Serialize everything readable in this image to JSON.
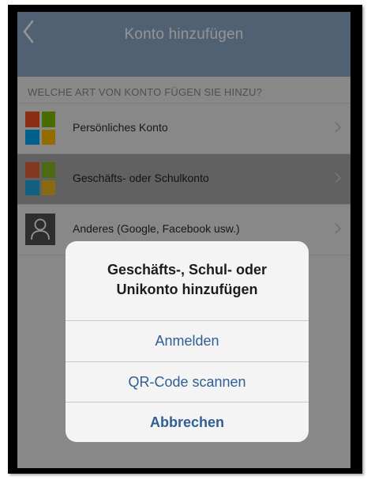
{
  "navbar": {
    "title": "Konto hinzufügen",
    "back_icon": "chevron-left-icon"
  },
  "account_types": {
    "header": "WELCHE ART VON KONTO FÜGEN SIE HINZU?",
    "items": [
      {
        "label": "Persönliches Konto",
        "icon": "microsoft-logo-icon"
      },
      {
        "label": "Geschäfts- oder Schulkonto",
        "icon": "microsoft-logo-icon",
        "selected": true
      },
      {
        "label": "Anderes (Google, Facebook usw.)",
        "icon": "user-icon"
      }
    ]
  },
  "action_sheet": {
    "title_line1": "Geschäfts-, Schul- oder",
    "title_line2": "Unikonto hinzufügen",
    "sign_in_label": "Anmelden",
    "scan_qr_label": "QR-Code scannen",
    "cancel_label": "Abbrechen"
  },
  "colors": {
    "navbar": "#8ba8c6",
    "ms_red": "#f25022",
    "ms_green": "#7fba00",
    "ms_blue": "#00a4ef",
    "ms_yellow": "#ffb900",
    "action_text": "#2f5e94"
  }
}
